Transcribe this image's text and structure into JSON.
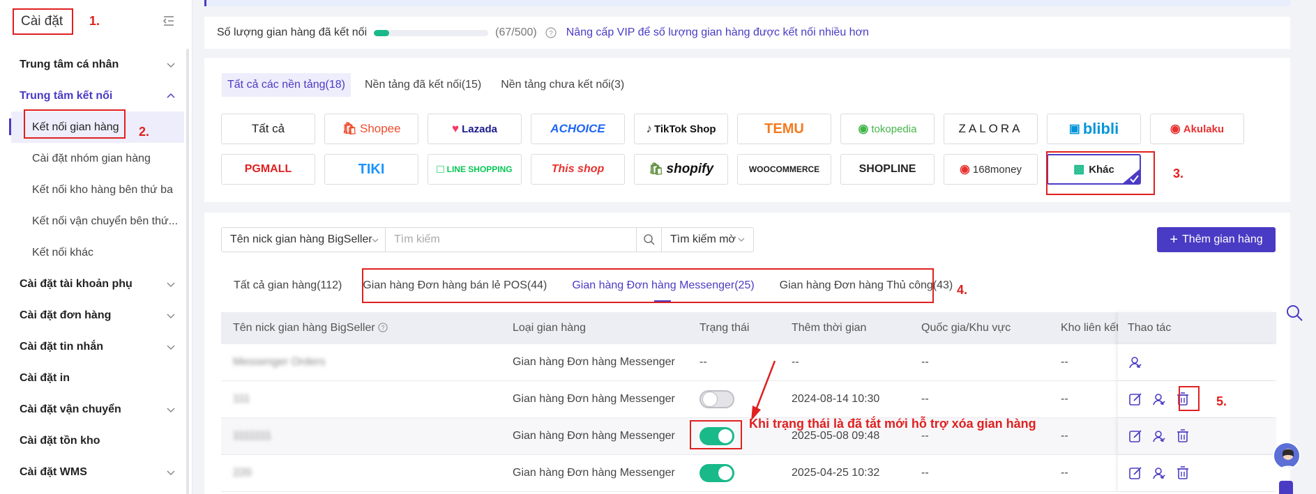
{
  "sidebar": {
    "title": "Cài đặt",
    "items": [
      {
        "label": "Trung tâm cá nhân"
      },
      {
        "label": "Trung tâm kết nối"
      },
      {
        "label": "Kết nối gian hàng"
      },
      {
        "label": "Cài đặt nhóm gian hàng"
      },
      {
        "label": "Kết nối kho hàng bên thứ ba"
      },
      {
        "label": "Kết nối vận chuyển bên thứ..."
      },
      {
        "label": "Kết nối khác"
      },
      {
        "label": "Cài đặt tài khoản phụ"
      },
      {
        "label": "Cài đặt đơn hàng"
      },
      {
        "label": "Cài đặt tin nhắn"
      },
      {
        "label": "Cài đặt in"
      },
      {
        "label": "Cài đặt vận chuyển"
      },
      {
        "label": "Cài đặt tồn kho"
      },
      {
        "label": "Cài đặt WMS"
      }
    ]
  },
  "annotations": {
    "n1": "1.",
    "n2": "2.",
    "n3": "3.",
    "n4": "4.",
    "n5": "5.",
    "callout": "Khi trạng thái là đã tắt mới hỗ trợ xóa gian hàng"
  },
  "quota": {
    "label": "Số lượng gian hàng đã kết nối",
    "count": "(67/500)",
    "progress": 0.134,
    "vip_link": "Nâng cấp VIP để số lượng gian hàng được kết nối nhiều hơn"
  },
  "platform_tabs": [
    "Tất cả các nền tảng(18)",
    "Nền tảng đã kết nối(15)",
    "Nền tảng chưa kết nối(3)"
  ],
  "platforms": {
    "all": "Tất cả",
    "shopee": "Shopee",
    "lazada": "Lazada",
    "achoice": "ACHOICE",
    "tiktok": "TikTok Shop",
    "temu": "TEMU",
    "tokopedia": "tokopedia",
    "zalora": "ZALORA",
    "blibli": "blibli",
    "akulaku": "Akulaku",
    "pgmall": "PGMALL",
    "tiki": "TIKI",
    "line": "LINE SHOPPING",
    "thisshop": "This shop",
    "shopify": "shopify",
    "woocommerce": "WOOCOMMERCE",
    "shopline": "SHOPLINE",
    "money168": "168money",
    "other": "Khác"
  },
  "search": {
    "nick_select": "Tên nick gian hàng BigSeller",
    "placeholder": "Tìm kiếm",
    "fuzzy": "Tìm kiếm mờ",
    "add_button": "Thêm gian hàng"
  },
  "store_tabs": [
    "Tất cả gian hàng(112)",
    "Gian hàng Đơn hàng bán lẻ POS(44)",
    "Gian hàng Đơn hàng Messenger(25)",
    "Gian hàng Đơn hàng Thủ công(43)"
  ],
  "table": {
    "headers": [
      "Tên nick gian hàng BigSeller",
      "Loại gian hàng",
      "Trạng thái",
      "Thêm thời gian",
      "Quốc gia/Khu vực",
      "Kho liên kết",
      "Thao tác"
    ],
    "rows": [
      {
        "name": "Messenger Orders",
        "type": "Gian hàng Đơn hàng Messenger",
        "status_text": "--",
        "time": "--",
        "country": "--",
        "warehouse": "--"
      },
      {
        "name": "111",
        "type": "Gian hàng Đơn hàng Messenger",
        "status": "off",
        "time": "2024-08-14 10:30",
        "country": "--",
        "warehouse": "--"
      },
      {
        "name": "1111111",
        "type": "Gian hàng Đơn hàng Messenger",
        "status": "on",
        "time": "2025-05-08 09:48",
        "country": "--",
        "warehouse": "--"
      },
      {
        "name": "220",
        "type": "Gian hàng Đơn hàng Messenger",
        "status": "on",
        "time": "2025-04-25 10:32",
        "country": "--",
        "warehouse": "--"
      }
    ]
  },
  "colors": {
    "accent": "#4a3bc4",
    "annotation": "#e02020",
    "toggle_on": "#19b98a"
  }
}
